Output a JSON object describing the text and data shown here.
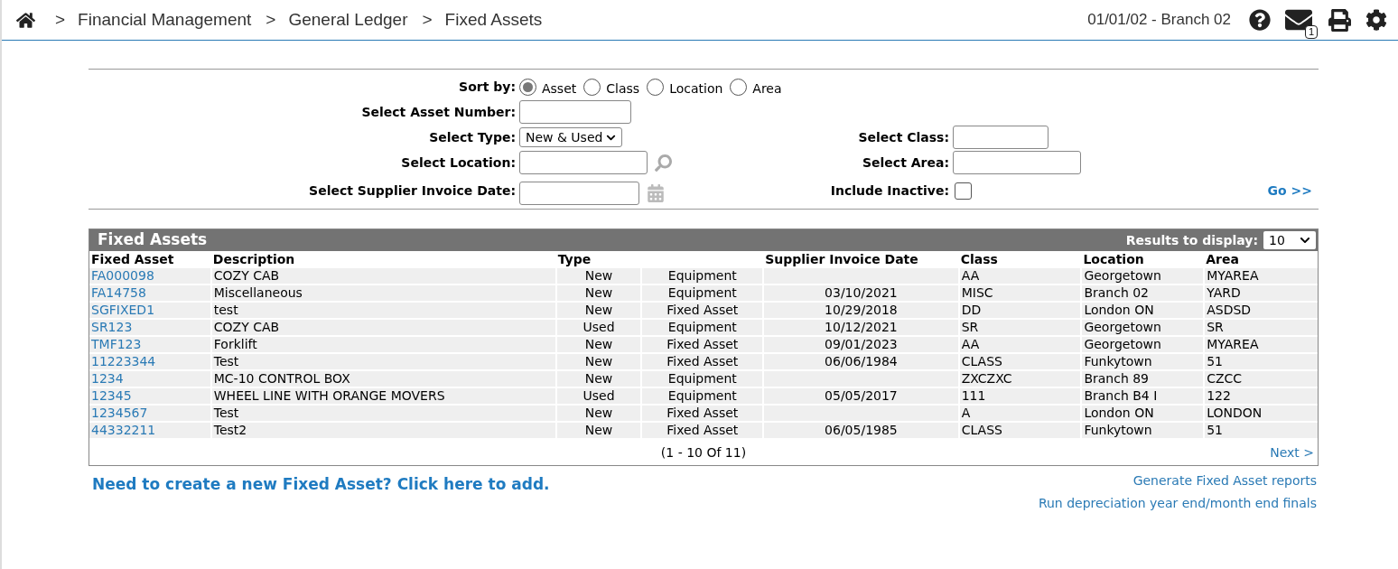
{
  "breadcrumb": [
    {
      "separator": ">",
      "label": "Financial Management"
    },
    {
      "separator": ">",
      "label": "General Ledger"
    },
    {
      "separator": ">",
      "label": "Fixed Assets"
    }
  ],
  "header": {
    "date_branch": "01/01/02 - Branch 02",
    "mail_count": "1"
  },
  "filters": {
    "sort_label": "Sort by:",
    "sort_options": [
      {
        "label": "Asset",
        "selected": true
      },
      {
        "label": "Class",
        "selected": false
      },
      {
        "label": "Location",
        "selected": false
      },
      {
        "label": "Area",
        "selected": false
      }
    ],
    "asset_number_label": "Select Asset Number:",
    "type_label": "Select Type:",
    "type_value": "New & Used",
    "class_label": "Select Class:",
    "location_label": "Select Location:",
    "area_label": "Select Area:",
    "invoice_date_label": "Select Supplier Invoice Date:",
    "inactive_label": "Include Inactive:",
    "inactive_checked": false,
    "go": "Go >>"
  },
  "table": {
    "title": "Fixed Assets",
    "results_label": "Results to display:",
    "results_value": "10",
    "columns": [
      "Fixed Asset",
      "Description",
      "Type",
      "Supplier Invoice Date",
      "Class",
      "Location",
      "Area"
    ],
    "rows": [
      {
        "asset": "FA000098",
        "description": "COZY CAB",
        "type": "New",
        "category": "Equipment",
        "date": "",
        "class": "AA",
        "location": "Georgetown",
        "area": "MYAREA"
      },
      {
        "asset": "FA14758",
        "description": "Miscellaneous",
        "type": "New",
        "category": "Equipment",
        "date": "03/10/2021",
        "class": "MISC",
        "location": "Branch 02",
        "area": "YARD"
      },
      {
        "asset": "SGFIXED1",
        "description": "test",
        "type": "New",
        "category": "Fixed Asset",
        "date": "10/29/2018",
        "class": "DD",
        "location": "London ON",
        "area": "ASDSD"
      },
      {
        "asset": "SR123",
        "description": "COZY CAB",
        "type": "Used",
        "category": "Equipment",
        "date": "10/12/2021",
        "class": "SR",
        "location": "Georgetown",
        "area": "SR"
      },
      {
        "asset": "TMF123",
        "description": "Forklift",
        "type": "New",
        "category": "Fixed Asset",
        "date": "09/01/2023",
        "class": "AA",
        "location": "Georgetown",
        "area": "MYAREA"
      },
      {
        "asset": "11223344",
        "description": "Test",
        "type": "New",
        "category": "Fixed Asset",
        "date": "06/06/1984",
        "class": "CLASS",
        "location": "Funkytown",
        "area": "51"
      },
      {
        "asset": "1234",
        "description": "MC-10 CONTROL BOX",
        "type": "New",
        "category": "Equipment",
        "date": "",
        "class": "ZXCZXC",
        "location": "Branch 89",
        "area": "CZCC"
      },
      {
        "asset": "12345",
        "description": "WHEEL LINE WITH ORANGE MOVERS",
        "type": "Used",
        "category": "Equipment",
        "date": "05/05/2017",
        "class": "111",
        "location": "Branch B4 I",
        "area": "122"
      },
      {
        "asset": "1234567",
        "description": "Test",
        "type": "New",
        "category": "Fixed Asset",
        "date": "",
        "class": "A",
        "location": "London ON",
        "area": "LONDON"
      },
      {
        "asset": "44332211",
        "description": "Test2",
        "type": "New",
        "category": "Fixed Asset",
        "date": "06/05/1985",
        "class": "CLASS",
        "location": "Funkytown",
        "area": "51"
      }
    ],
    "pagination": "(1 - 10 Of 11)",
    "next": "Next >"
  },
  "footer": {
    "add_link": "Need to create a new Fixed Asset? Click here to add.",
    "links": [
      "Generate Fixed Asset reports",
      "Run depreciation year end/month end finals"
    ]
  }
}
